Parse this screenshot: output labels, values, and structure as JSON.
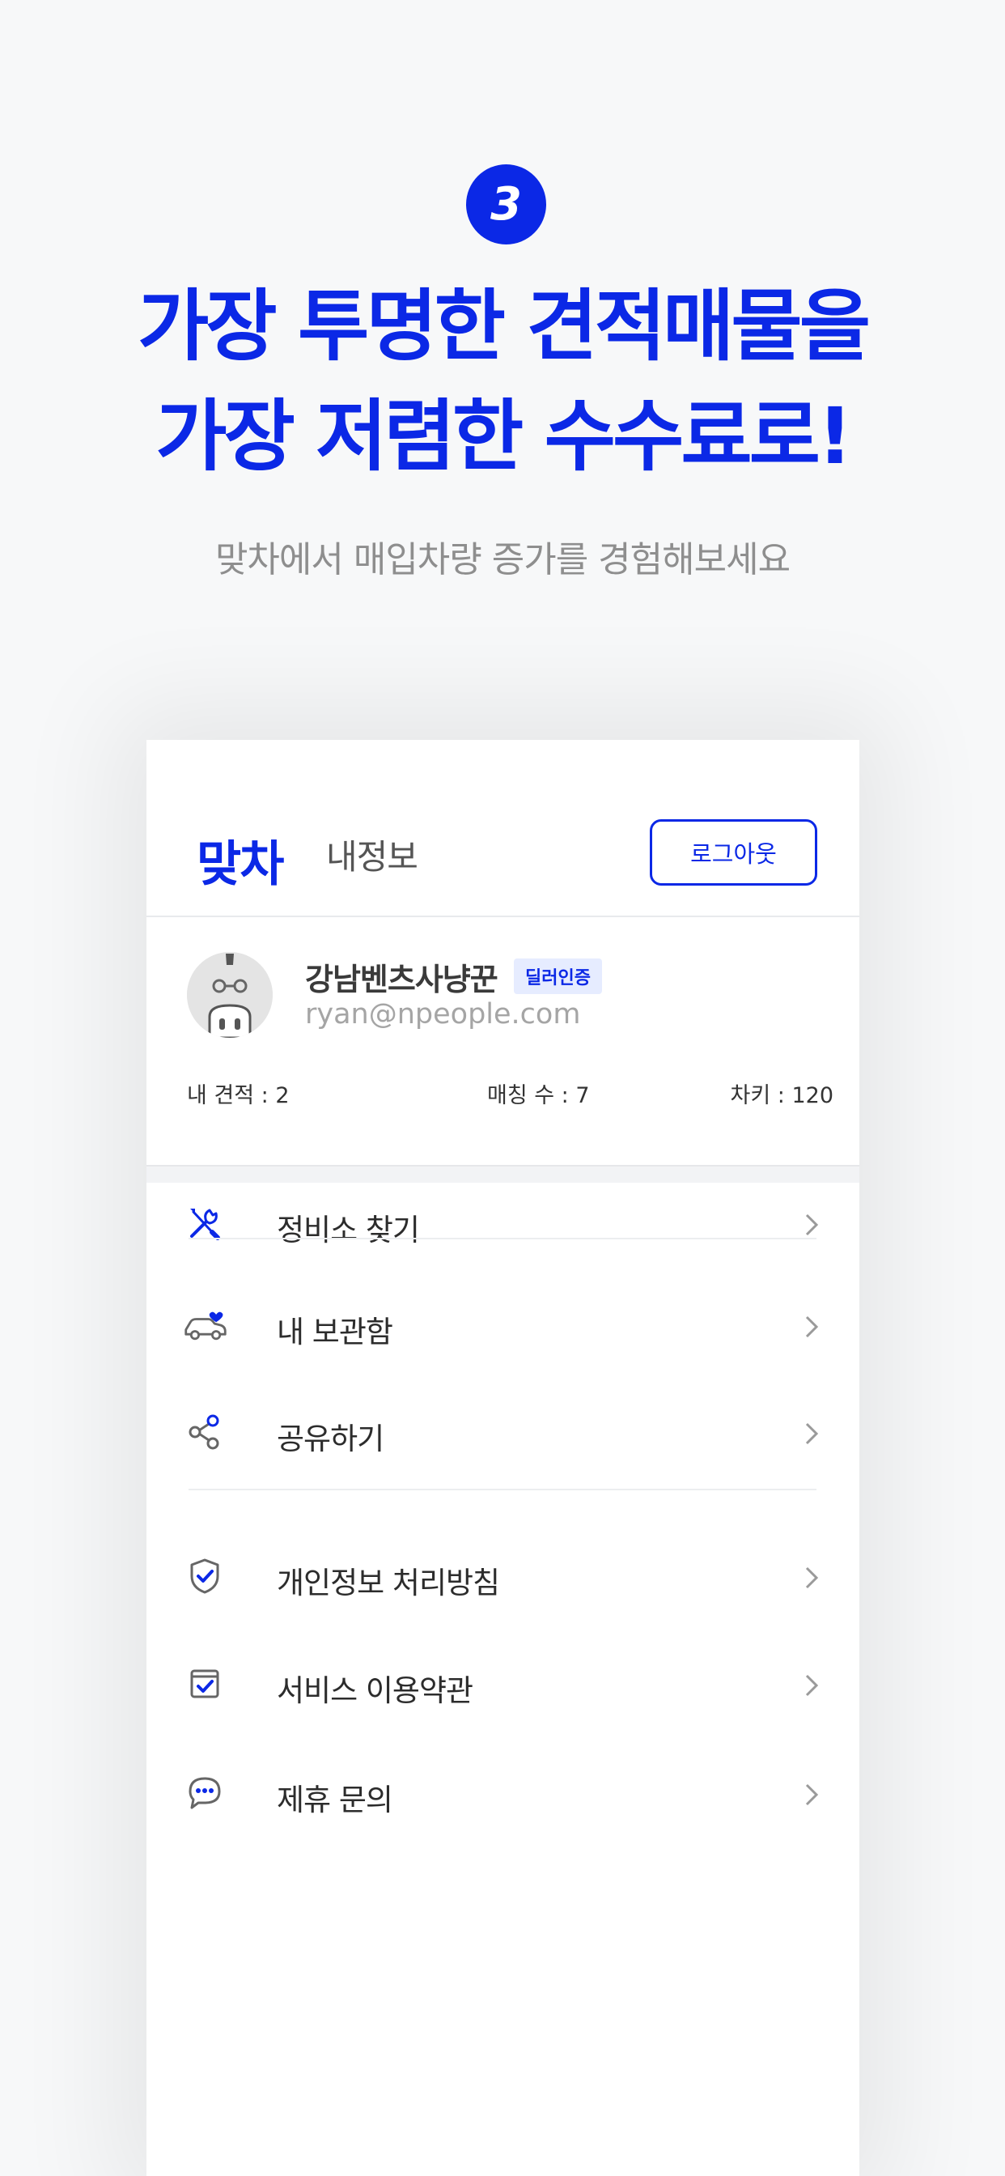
{
  "promo": {
    "step_number": "3",
    "headline_line1": "가장 투명한 견적매물을",
    "headline_line2": "가장 저렴한 수수료로!",
    "subheadline": "맞차에서 매입차량 증가를 경험해보세요"
  },
  "app": {
    "logo": "맞차",
    "header_title": "내정보",
    "logout_label": "로그아웃",
    "profile": {
      "name": "강남벤츠사냥꾼",
      "badge": "딜러인증",
      "email": "ryan@npeople.com"
    },
    "stats": {
      "estimates": "내 견적 : 2",
      "matches": "매칭 수 : 7",
      "keys": "차키 : 120"
    },
    "menu": [
      {
        "label": "정비소 찾기",
        "icon": "wrench-screwdriver-icon"
      },
      {
        "label": "내 보관함",
        "icon": "car-heart-icon"
      },
      {
        "label": "공유하기",
        "icon": "share-icon"
      },
      {
        "label": "개인정보 처리방침",
        "icon": "shield-check-icon"
      },
      {
        "label": "서비스 이용약관",
        "icon": "checkbox-icon"
      },
      {
        "label": "제휴 문의",
        "icon": "chat-bubble-icon"
      }
    ]
  },
  "colors": {
    "brand_blue": "#0b28e6",
    "background": "#f7f8f9",
    "text_gray": "#8e8e8e"
  }
}
